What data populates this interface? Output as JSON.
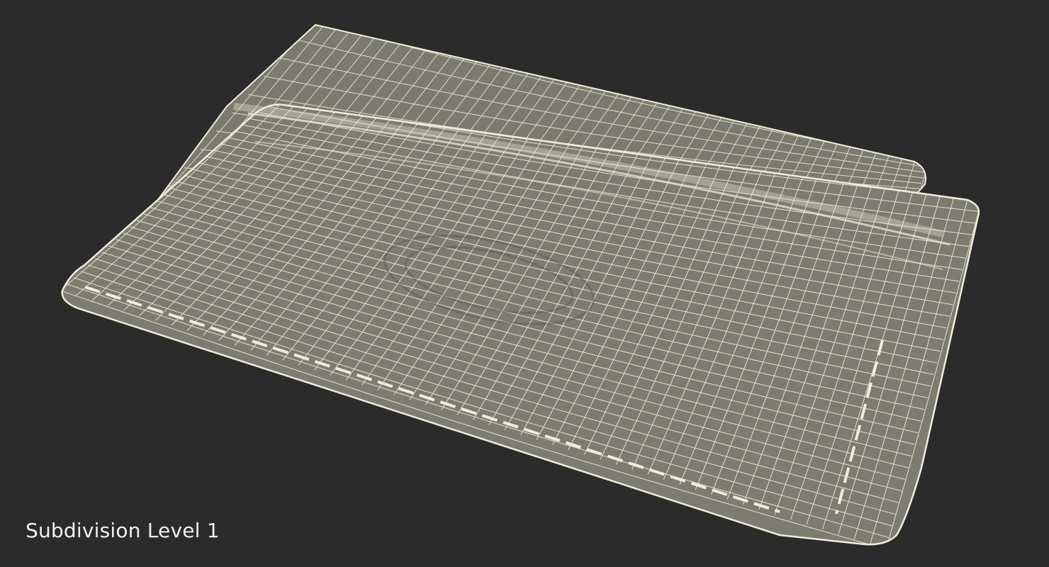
{
  "caption": "Subdivision Level 1",
  "colors": {
    "background": "#2b2b2b",
    "surface": "#7c7c70",
    "wire": "#efecd8",
    "caption": "#f0f0f0"
  }
}
